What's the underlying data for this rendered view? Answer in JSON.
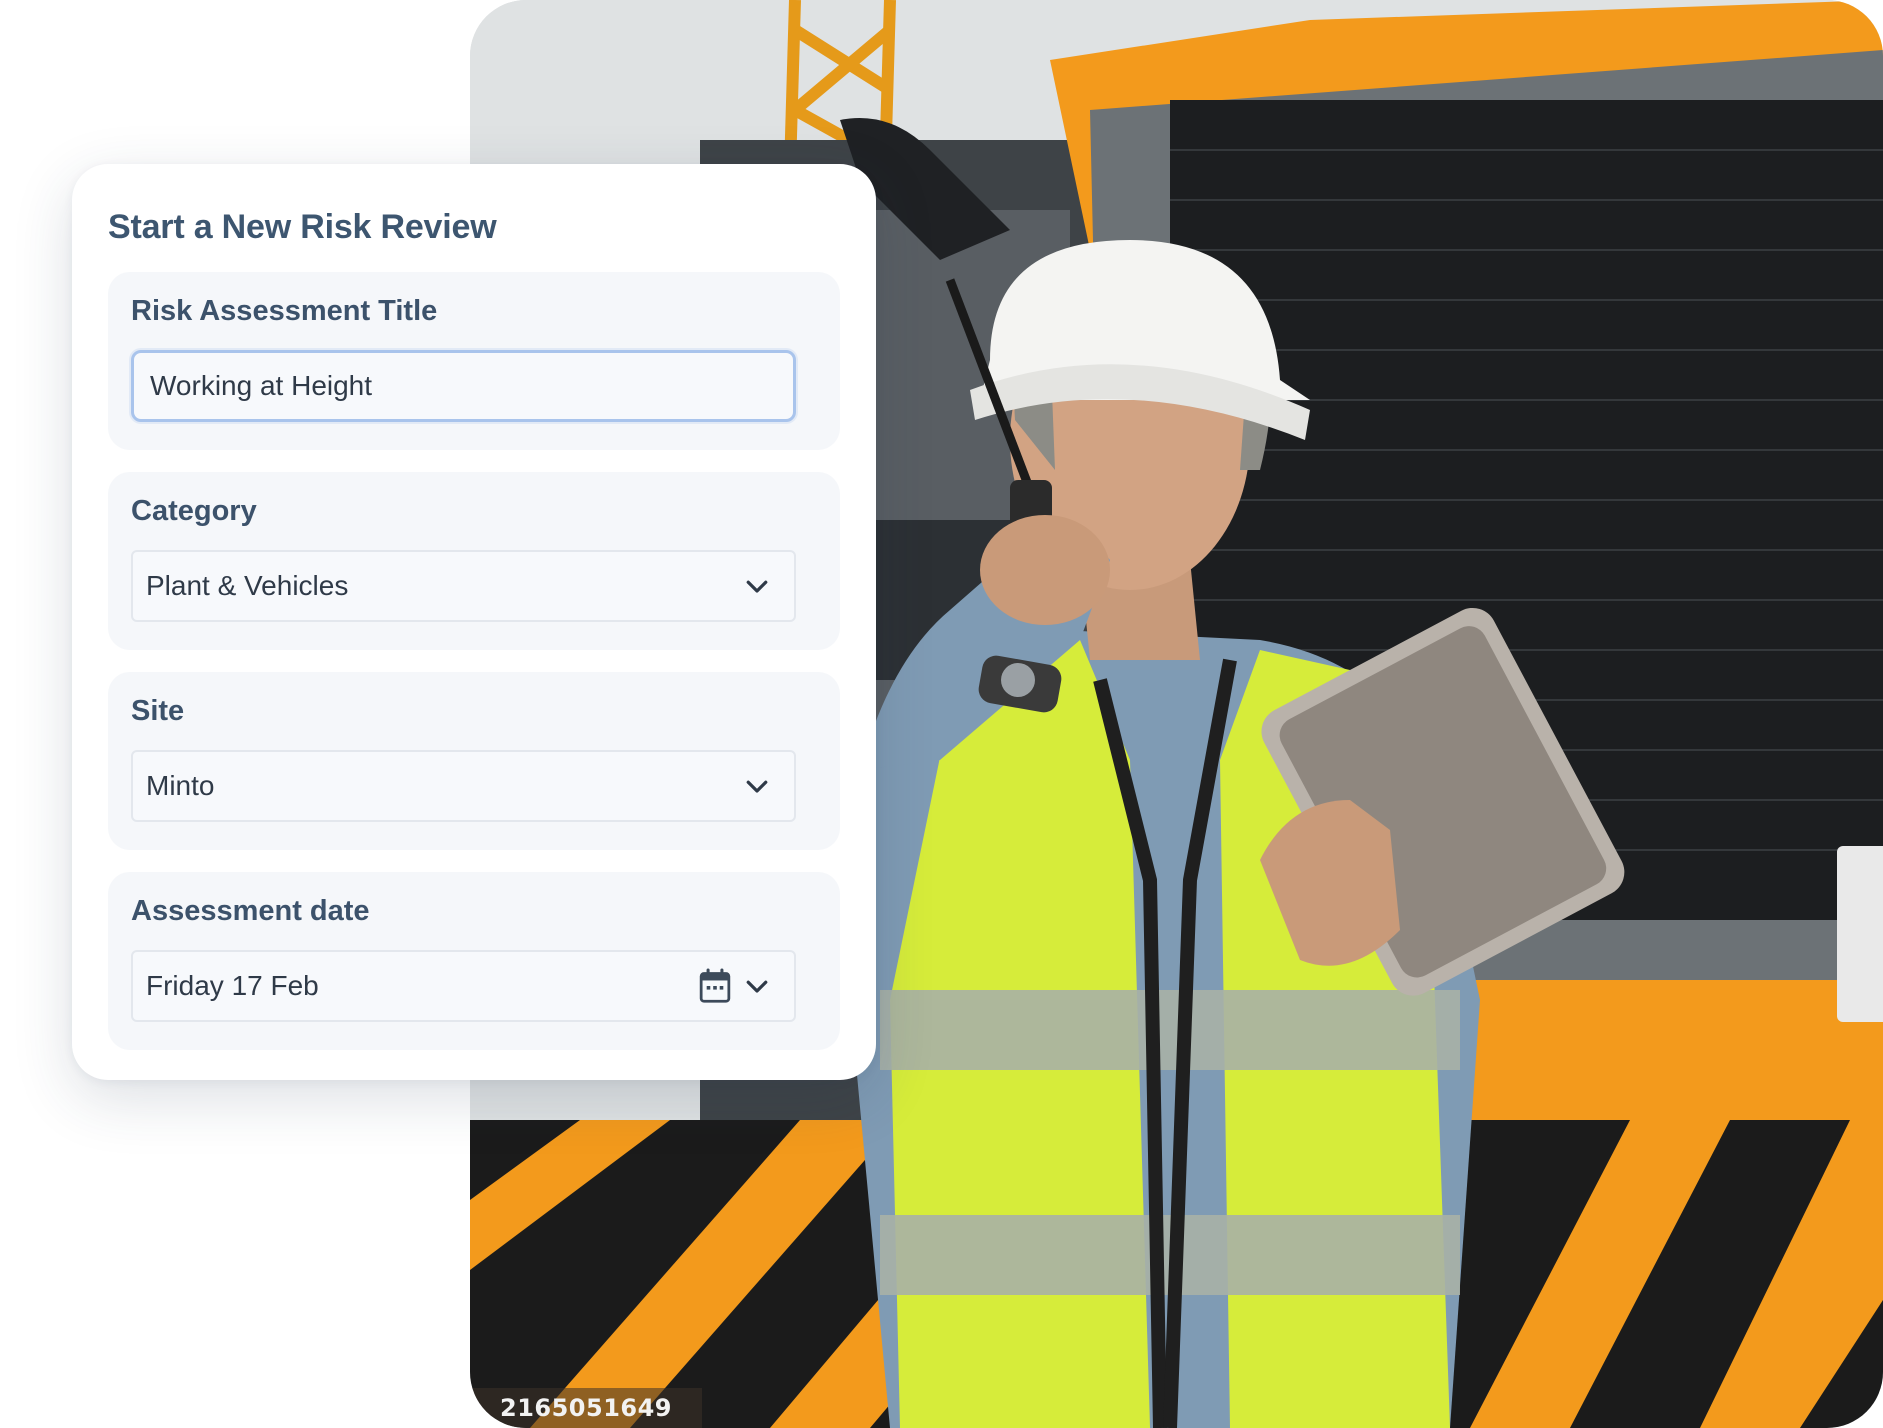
{
  "form": {
    "title": "Start a New Risk Review",
    "fields": [
      {
        "label": "Risk Assessment Title",
        "value": "Working at Height",
        "type": "text"
      },
      {
        "label": "Category",
        "value": "Plant & Vehicles",
        "type": "select"
      },
      {
        "label": "Site",
        "value": "Minto",
        "type": "select"
      },
      {
        "label": "Assessment date",
        "value": "Friday 17 Feb",
        "type": "date"
      }
    ]
  },
  "photo": {
    "stock_id": "2165051649"
  },
  "icons": {
    "dropdown": "chevron-down-icon",
    "date": "calendar-icon"
  },
  "colors": {
    "title_text": "#3d5670",
    "field_background": "#f5f7fa",
    "focus_border": "#a9c4ec",
    "vest_yellow": "#d6ec3a",
    "hazard_orange": "#f39a1c"
  }
}
